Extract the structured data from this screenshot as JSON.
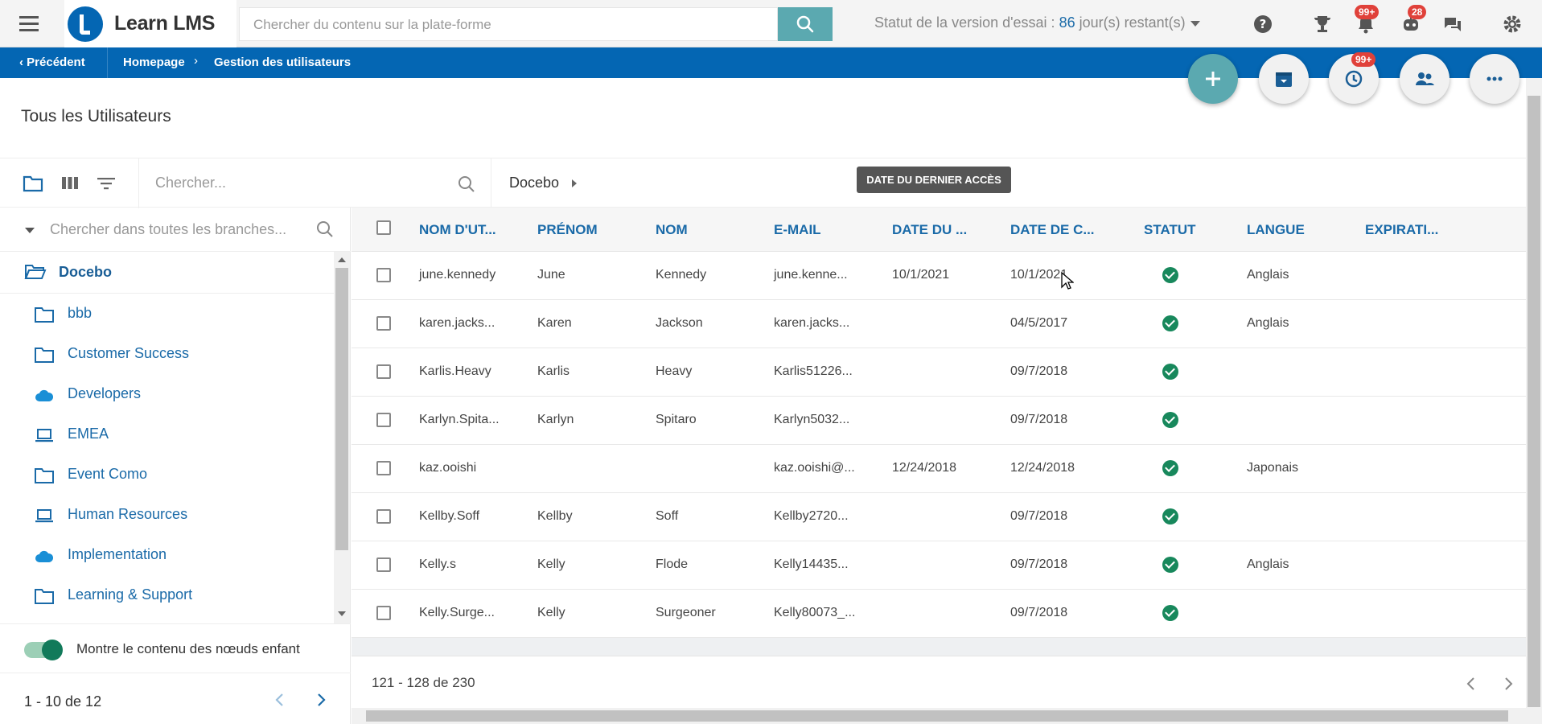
{
  "app": {
    "logo_text": "Learn LMS",
    "search_placeholder": "Chercher du contenu sur la plate-forme",
    "trial_prefix": "Statut de la version d'essai : ",
    "trial_days": "86",
    "trial_suffix": " jour(s) restant(s)",
    "badges": {
      "notifications": "99+",
      "messages": "28",
      "fab_history": "99+"
    }
  },
  "breadcrumb": {
    "back_label": "Précédent",
    "items": [
      "Homepage",
      "Gestion des utilisateurs"
    ]
  },
  "page": {
    "title": "Tous les Utilisateurs",
    "user_search_placeholder": "Chercher...",
    "tree_crumb": "Docebo",
    "tooltip": "DATE DU DERNIER ACCÈS"
  },
  "tree": {
    "search_placeholder": "Chercher dans toutes les branches...",
    "root": "Docebo",
    "items": [
      {
        "label": "bbb",
        "icon": "folder-icon"
      },
      {
        "label": "Customer Success",
        "icon": "folder-icon"
      },
      {
        "label": "Developers",
        "icon": "cloud-icon"
      },
      {
        "label": "EMEA",
        "icon": "laptop-icon"
      },
      {
        "label": "Event Como",
        "icon": "folder-icon"
      },
      {
        "label": "Human Resources",
        "icon": "laptop-icon"
      },
      {
        "label": "Implementation",
        "icon": "cloud-icon"
      },
      {
        "label": "Learning & Support",
        "icon": "folder-icon"
      }
    ],
    "toggle_label": "Montre le contenu des nœuds enfant",
    "pager": "1 - 10 de 12"
  },
  "table": {
    "columns": [
      "NOM D'UT...",
      "PRÉNOM",
      "NOM",
      "E-MAIL",
      "DATE DU ...",
      "DATE DE C...",
      "STATUT",
      "LANGUE",
      "EXPIRATI..."
    ],
    "rows": [
      {
        "username": "june.kennedy",
        "first": "June",
        "last": "Kennedy",
        "email": "june.kenne...",
        "last_access": "10/1/2021",
        "created": "10/1/2021",
        "status": "active",
        "lang": "Anglais",
        "expiry": ""
      },
      {
        "username": "karen.jacks...",
        "first": "Karen",
        "last": "Jackson",
        "email": "karen.jacks...",
        "last_access": "",
        "created": "04/5/2017",
        "status": "active",
        "lang": "Anglais",
        "expiry": ""
      },
      {
        "username": "Karlis.Heavy",
        "first": "Karlis",
        "last": "Heavy",
        "email": "Karlis51226...",
        "last_access": "",
        "created": "09/7/2018",
        "status": "active",
        "lang": "",
        "expiry": ""
      },
      {
        "username": "Karlyn.Spita...",
        "first": "Karlyn",
        "last": "Spitaro",
        "email": "Karlyn5032...",
        "last_access": "",
        "created": "09/7/2018",
        "status": "active",
        "lang": "",
        "expiry": ""
      },
      {
        "username": "kaz.ooishi",
        "first": "",
        "last": "",
        "email": "kaz.ooishi@...",
        "last_access": "12/24/2018",
        "created": "12/24/2018",
        "status": "active",
        "lang": "Japonais",
        "expiry": ""
      },
      {
        "username": "Kellby.Soff",
        "first": "Kellby",
        "last": "Soff",
        "email": "Kellby2720...",
        "last_access": "",
        "created": "09/7/2018",
        "status": "active",
        "lang": "",
        "expiry": ""
      },
      {
        "username": "Kelly.s",
        "first": "Kelly",
        "last": "Flode",
        "email": "Kelly14435...",
        "last_access": "",
        "created": "09/7/2018",
        "status": "active",
        "lang": "Anglais",
        "expiry": ""
      },
      {
        "username": "Kelly.Surge...",
        "first": "Kelly",
        "last": "Surgeoner",
        "email": "Kelly80073_...",
        "last_access": "",
        "created": "09/7/2018",
        "status": "active",
        "lang": "",
        "expiry": ""
      }
    ],
    "footer_count": "121 - 128 de 230"
  },
  "colors": {
    "brand_blue": "#0466b3",
    "teal": "#5ba9b0",
    "status_green": "#18885c",
    "badge_red": "#e0413a"
  }
}
